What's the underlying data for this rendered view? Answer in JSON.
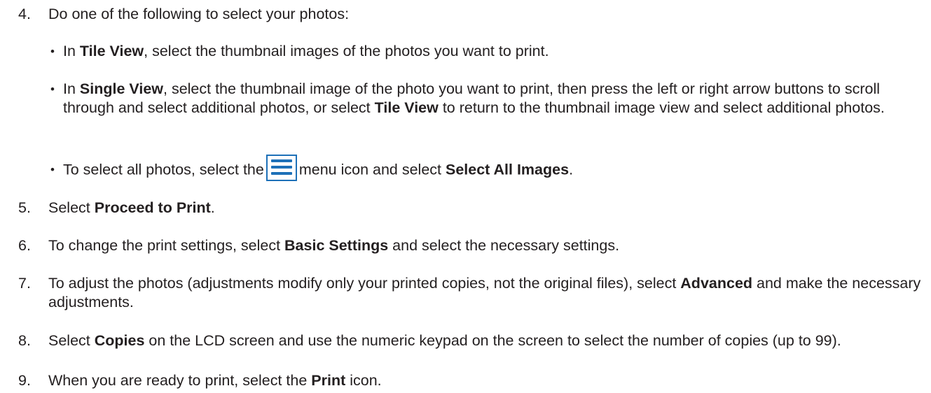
{
  "steps": [
    {
      "num": "4.",
      "text": "Do one of the following to select your photos:",
      "bullets": [
        {
          "pre": "In ",
          "b1": "Tile View",
          "post": ", select the thumbnail images of the photos you want to print."
        },
        {
          "pre": "In ",
          "b1": "Single View",
          "mid": ", select the thumbnail image of the photo you want to print, then press the left or right arrow buttons to scroll through and select additional photos, or select ",
          "b2": "Tile View",
          "post": " to return to the thumbnail image view and select additional photos."
        },
        {
          "pre": "To select all photos, select the",
          "icon": "menu-icon",
          "mid": "menu icon and select ",
          "b1": "Select All Images",
          "post": "."
        }
      ]
    },
    {
      "num": "5.",
      "pre": "Select ",
      "b1": "Proceed to Print",
      "post": "."
    },
    {
      "num": "6.",
      "pre": "To change the print settings, select ",
      "b1": "Basic Settings",
      "post": " and select the necessary settings."
    },
    {
      "num": "7.",
      "pre": "To adjust the photos (adjustments modify only your printed copies, not the original files), select ",
      "b1": "Advanced",
      "post": " and make the necessary adjustments."
    },
    {
      "num": "8.",
      "pre": "Select ",
      "b1": "Copies",
      "post": " on the LCD screen and use the numeric keypad on the screen to select the number of copies (up to 99)."
    },
    {
      "num": "9.",
      "pre": "When you are ready to print, select the ",
      "b1": "Print",
      "post": " icon."
    }
  ],
  "colors": {
    "text": "#231f20",
    "icon_accent": "#1d70b8"
  }
}
